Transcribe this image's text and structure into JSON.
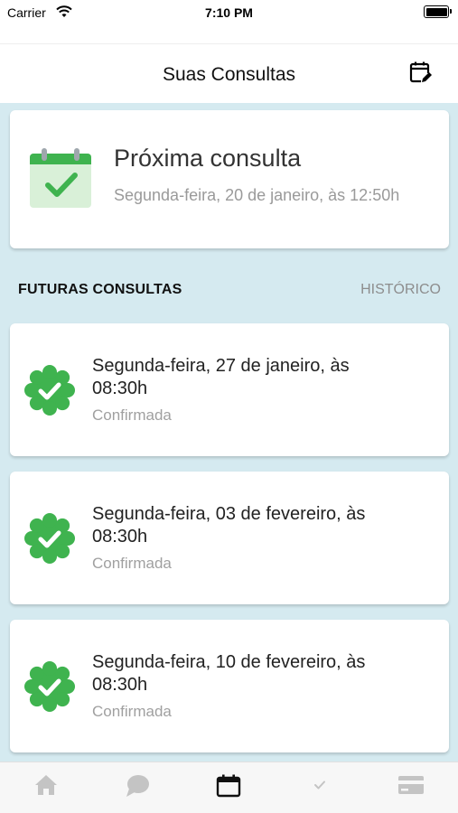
{
  "status_bar": {
    "carrier": "Carrier",
    "time": "7:10 PM",
    "wifi_icon": "wifi-icon",
    "battery_icon": "battery-icon"
  },
  "header": {
    "title": "Suas Consultas",
    "action_icon": "calendar-edit-icon"
  },
  "next_appointment": {
    "title": "Próxima consulta",
    "date": "Segunda-feira, 20 de janeiro, às 12:50h",
    "icon": "calendar-check-icon"
  },
  "section": {
    "upcoming_label": "FUTURAS CONSULTAS",
    "history_label": "HISTÓRICO"
  },
  "appointments": [
    {
      "date": "Segunda-feira, 27 de janeiro, às 08:30h",
      "status": "Confirmada",
      "icon": "verified-check-icon"
    },
    {
      "date": "Segunda-feira, 03 de fevereiro, às 08:30h",
      "status": "Confirmada",
      "icon": "verified-check-icon"
    },
    {
      "date": "Segunda-feira, 10 de fevereiro, às 08:30h",
      "status": "Confirmada",
      "icon": "verified-check-icon"
    }
  ],
  "tab_bar": {
    "tabs": [
      {
        "icon": "home-icon",
        "active": false
      },
      {
        "icon": "chat-icon",
        "active": false
      },
      {
        "icon": "calendar-icon",
        "active": true
      },
      {
        "icon": "check-icon",
        "active": false
      },
      {
        "icon": "credit-card-icon",
        "active": false
      }
    ]
  },
  "colors": {
    "accent_green": "#3fb34f",
    "light_green": "#d9f0d8",
    "background": "#d5eaf0",
    "muted_text": "#9a9a9a",
    "inactive_tab": "#c4c4c4"
  }
}
